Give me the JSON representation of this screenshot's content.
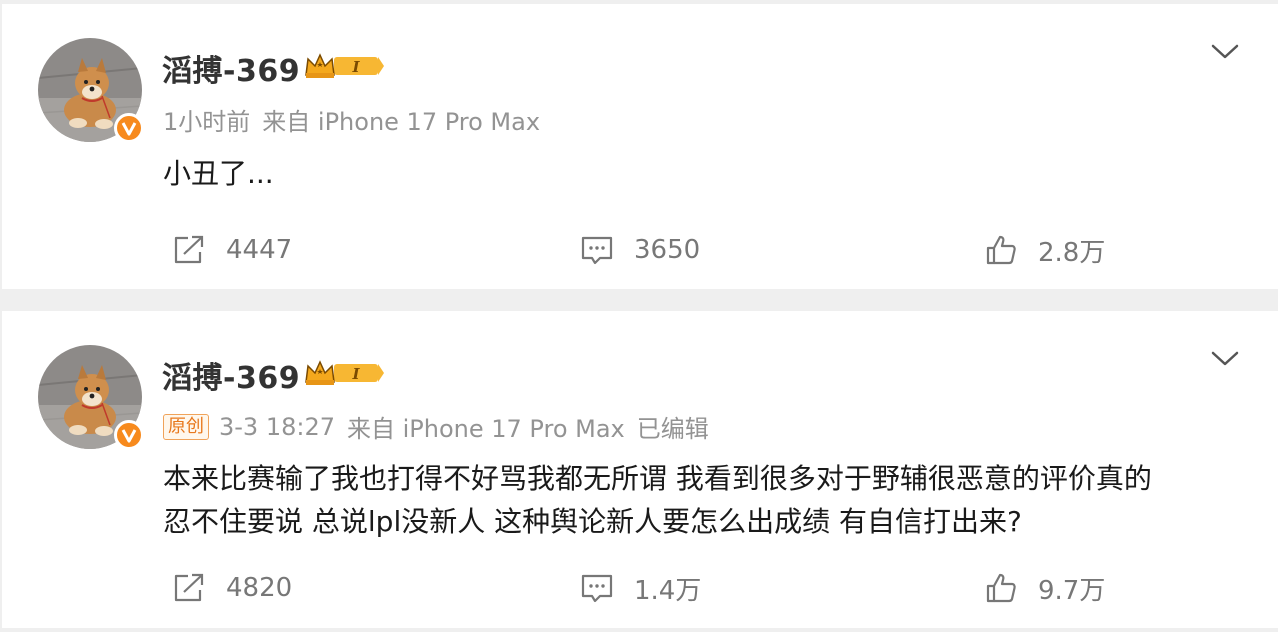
{
  "colors": {
    "background": "#efefef",
    "card": "#ffffff",
    "username": "#333333",
    "meta": "#939393",
    "verified_badge": "#f78a1d",
    "action_text": "#777777",
    "original_tag": "#e8781c"
  },
  "posts": [
    {
      "username": "滔搏-369",
      "level_badge": "I",
      "original_tag": "",
      "meta": {
        "time": "1小时前",
        "source": "来自 iPhone 17 Pro Max",
        "edited": ""
      },
      "content_lines": [
        "小丑了..."
      ],
      "actions": {
        "repost_count": "4447",
        "comment_count": "3650",
        "like_count": "2.8万"
      },
      "icons": {
        "avatar": "shiba-inu-avatar",
        "verified": "verified-v-icon",
        "menu": "chevron-down-icon",
        "repost": "repost-icon",
        "comment": "comment-icon",
        "like": "thumbs-up-icon"
      }
    },
    {
      "username": "滔搏-369",
      "level_badge": "I",
      "original_tag": "原创",
      "meta": {
        "time": "3-3 18:27",
        "source": "来自 iPhone 17 Pro Max",
        "edited": "已编辑"
      },
      "content_lines": [
        "本来比赛输了我也打得不好骂我都无所谓 我看到很多对于野辅很恶意的评价真的",
        "忍不住要说 总说lpl没新人 这种舆论新人要怎么出成绩 有自信打出来?"
      ],
      "actions": {
        "repost_count": "4820",
        "comment_count": "1.4万",
        "like_count": "9.7万"
      },
      "icons": {
        "avatar": "shiba-inu-avatar",
        "verified": "verified-v-icon",
        "menu": "chevron-down-icon",
        "repost": "repost-icon",
        "comment": "comment-icon",
        "like": "thumbs-up-icon"
      }
    }
  ]
}
